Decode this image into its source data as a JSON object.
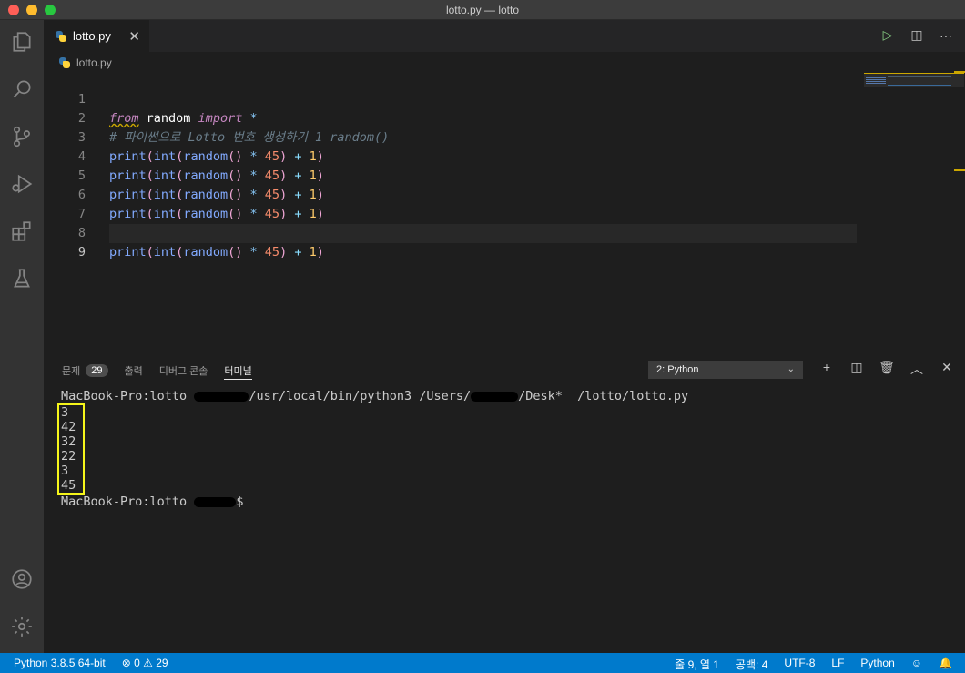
{
  "window": {
    "title": "lotto.py — lotto"
  },
  "editor": {
    "tab_label": "lotto.py",
    "breadcrumb": "lotto.py",
    "line_numbers": [
      "1",
      "2",
      "3",
      "4",
      "5",
      "6",
      "7",
      "8",
      "9"
    ],
    "lines": {
      "l1": {
        "from": "from",
        "module": "random",
        "import": "import",
        "star": "*"
      },
      "l2": "# 파이썬으로 Lotto 번호 생성하기 1 random()",
      "print_stmt": {
        "print": "print",
        "int": "int",
        "random": "random",
        "open": "(",
        "close": ")",
        "mul": "*",
        "n45": "45",
        "plus": "+",
        "n1": "1"
      }
    }
  },
  "panel": {
    "tabs": [
      {
        "label": "문제",
        "badge": "29"
      },
      {
        "label": "출력"
      },
      {
        "label": "디버그 콘솔"
      },
      {
        "label": "터미널"
      }
    ],
    "terminal_select": "2: Python",
    "terminal": {
      "prompt_cmd_a": "MacBook-Pro:lotto ",
      "prompt_cmd_b": "/usr/local/bin/python3 /Users/",
      "prompt_cmd_c": "/Desk*  /lotto/lotto.py",
      "outputs": [
        "3",
        "42",
        "32",
        "22",
        "3",
        "45"
      ],
      "prompt_end": "MacBook-Pro:lotto ",
      "prompt_dollar": "$"
    }
  },
  "status": {
    "interpreter": "Python 3.8.5 64-bit",
    "problems": "⊗ 0 ⚠ 29",
    "cursor": "줄 9, 열 1",
    "spaces": "공백: 4",
    "encoding": "UTF-8",
    "eol": "LF",
    "language": "Python"
  },
  "icons": {
    "close": "✕",
    "run": "▷",
    "split": "◫",
    "more": "···",
    "chevron_down": "⌄",
    "add": "+",
    "trash": "🗑",
    "maximize": "︿",
    "panel_close": "✕",
    "feedback": "☺",
    "bell": "🔔"
  },
  "colors": {
    "accent": "#007acc",
    "highlight_box": "#f5f51a"
  }
}
